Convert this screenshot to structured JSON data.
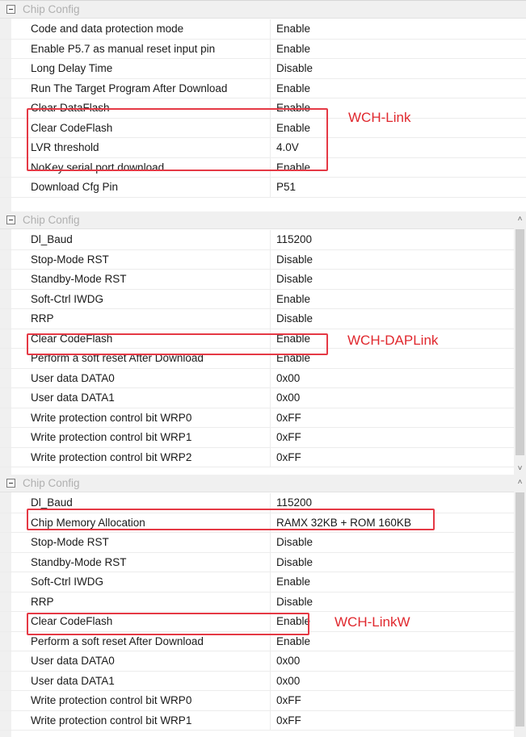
{
  "section_title": "Chip Config",
  "panels": {
    "wch_link": {
      "tag": "WCH-Link",
      "rows": [
        {
          "name": "Code and data protection mode",
          "value": "Enable"
        },
        {
          "name": "Enable P5.7 as manual reset input pin",
          "value": "Enable"
        },
        {
          "name": "Long Delay Time",
          "value": "Disable"
        },
        {
          "name": "Run The Target Program After Download",
          "value": "Enable"
        },
        {
          "name": "Clear DataFlash",
          "value": "Enable"
        },
        {
          "name": "Clear CodeFlash",
          "value": "Enable"
        },
        {
          "name": "LVR threshold",
          "value": "4.0V"
        },
        {
          "name": "NoKey serial port download",
          "value": "Enable"
        },
        {
          "name": "Download Cfg Pin",
          "value": "P51"
        }
      ]
    },
    "wch_daplink": {
      "tag": "WCH-DAPLink",
      "rows": [
        {
          "name": "Dl_Baud",
          "value": "115200"
        },
        {
          "name": "Stop-Mode RST",
          "value": "Disable"
        },
        {
          "name": "Standby-Mode RST",
          "value": "Disable"
        },
        {
          "name": "Soft-Ctrl IWDG",
          "value": "Enable"
        },
        {
          "name": "RRP",
          "value": "Disable"
        },
        {
          "name": "Clear CodeFlash",
          "value": "Enable"
        },
        {
          "name": "Perform a soft reset After Download",
          "value": "Enable"
        },
        {
          "name": "User data DATA0",
          "value": "0x00"
        },
        {
          "name": "User data DATA1",
          "value": "0x00"
        },
        {
          "name": "Write protection control bit WRP0",
          "value": "0xFF"
        },
        {
          "name": "Write protection control bit WRP1",
          "value": "0xFF"
        },
        {
          "name": "Write protection control bit WRP2",
          "value": "0xFF"
        }
      ]
    },
    "wch_linkw": {
      "tag": "WCH-LinkW",
      "rows": [
        {
          "name": "Dl_Baud",
          "value": "115200"
        },
        {
          "name": "Chip Memory Allocation",
          "value": "RAMX 32KB + ROM 160KB"
        },
        {
          "name": "Stop-Mode RST",
          "value": "Disable"
        },
        {
          "name": "Standby-Mode RST",
          "value": "Disable"
        },
        {
          "name": "Soft-Ctrl IWDG",
          "value": "Enable"
        },
        {
          "name": "RRP",
          "value": "Disable"
        },
        {
          "name": "Clear CodeFlash",
          "value": "Enable"
        },
        {
          "name": "Perform a soft reset After Download",
          "value": "Enable"
        },
        {
          "name": "User data DATA0",
          "value": "0x00"
        },
        {
          "name": "User data DATA1",
          "value": "0x00"
        },
        {
          "name": "Write protection control bit WRP0",
          "value": "0xFF"
        },
        {
          "name": "Write protection control bit WRP1",
          "value": "0xFF"
        }
      ]
    }
  },
  "colors": {
    "highlight": "#e53945",
    "tag": "#e0282e",
    "header_text": "#b0b0b0"
  },
  "icons": {
    "collapse": "collapse-minus-icon",
    "scroll_up": "chevron-up-icon",
    "scroll_down": "chevron-down-icon"
  }
}
